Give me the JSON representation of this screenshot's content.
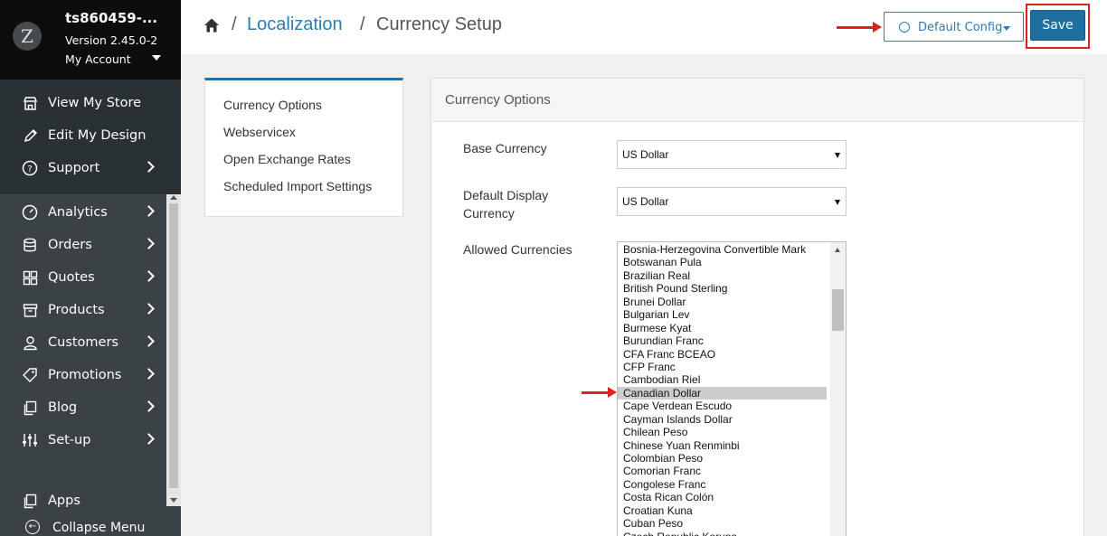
{
  "sidebar": {
    "store_name": "ts860459-...",
    "version": "Version 2.45.0-2",
    "account": "My Account",
    "top_items": [
      {
        "label": "View My Store",
        "icon": "store-icon"
      },
      {
        "label": "Edit My Design",
        "icon": "pencil-icon"
      },
      {
        "label": "Support",
        "icon": "question-icon"
      }
    ],
    "main_items": [
      {
        "label": "Analytics",
        "icon": "gauge-icon"
      },
      {
        "label": "Orders",
        "icon": "database-icon"
      },
      {
        "label": "Quotes",
        "icon": "grid-icon"
      },
      {
        "label": "Products",
        "icon": "box-icon"
      },
      {
        "label": "Customers",
        "icon": "user-icon"
      },
      {
        "label": "Promotions",
        "icon": "tag-icon"
      },
      {
        "label": "Blog",
        "icon": "copy-icon"
      },
      {
        "label": "Set-up",
        "icon": "sliders-icon"
      }
    ],
    "apps": "Apps",
    "collapse": "Collapse Menu"
  },
  "header": {
    "sep": "/",
    "crumb_link": "Localization",
    "crumb_current": "Currency Setup",
    "config_button": "Default Config",
    "save_button": "Save"
  },
  "subnav": {
    "items": [
      "Currency Options",
      "Webservicex",
      "Open Exchange Rates",
      "Scheduled Import Settings"
    ]
  },
  "panel": {
    "title": "Currency Options",
    "base_currency_label": "Base Currency",
    "base_currency_value": "US Dollar",
    "display_currency_label_1": "Default Display",
    "display_currency_label_2": "Currency",
    "display_currency_value": "US Dollar",
    "allowed_label": "Allowed Currencies",
    "allowed_options": [
      "Bosnia-Herzegovina Convertible Mark",
      "Botswanan Pula",
      "Brazilian Real",
      "British Pound Sterling",
      "Brunei Dollar",
      "Bulgarian Lev",
      "Burmese Kyat",
      "Burundian Franc",
      "CFA Franc BCEAO",
      "CFP Franc",
      "Cambodian Riel",
      "Canadian Dollar",
      "Cape Verdean Escudo",
      "Cayman Islands Dollar",
      "Chilean Peso",
      "Chinese Yuan Renminbi",
      "Colombian Peso",
      "Comorian Franc",
      "Congolese Franc",
      "Costa Rican Colón",
      "Croatian Kuna",
      "Cuban Peso",
      "Czech Republic Koruna"
    ],
    "selected_option": "Canadian Dollar"
  },
  "colors": {
    "accent": "#2a7db0",
    "save": "#1f6fa0",
    "highlight": "#e0201e",
    "sidebar": "#3a4246"
  }
}
